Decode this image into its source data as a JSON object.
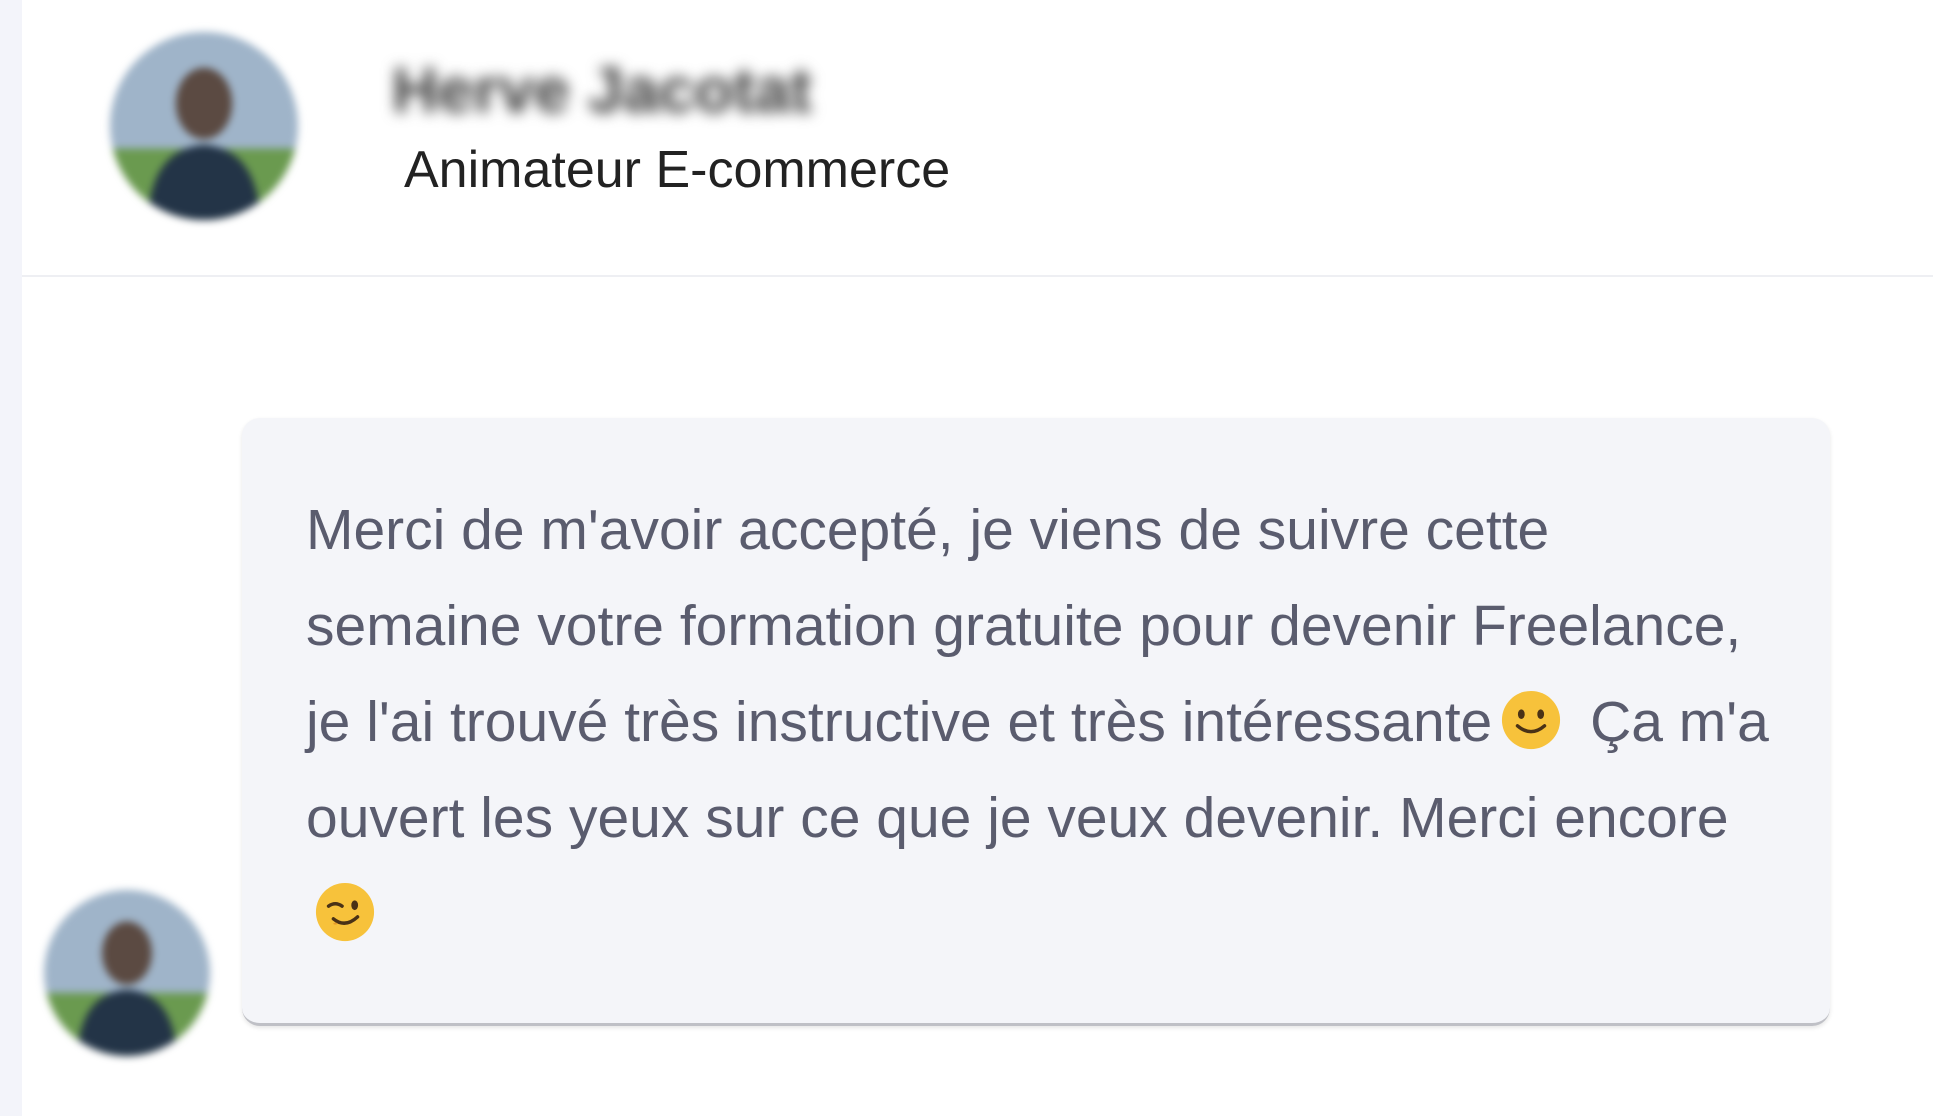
{
  "contact": {
    "name": "Herve Jacotat",
    "title": "Animateur E-commerce"
  },
  "message": {
    "part1": "Merci de m'avoir accepté, je viens de suivre cette semaine votre formation gratuite pour devenir Freelance, je l'ai trouvé très instructive et très intéressante",
    "part2": " Ça m'a ouvert les yeux sur ce que je veux devenir. Merci encore"
  },
  "icons": {
    "emoji1": "slightly-smiling-face-icon",
    "emoji2": "winking-face-icon"
  },
  "colors": {
    "bubble_background": "#f4f5f9",
    "message_text": "#5a5c6e",
    "left_strip": "#f3f4fa"
  }
}
